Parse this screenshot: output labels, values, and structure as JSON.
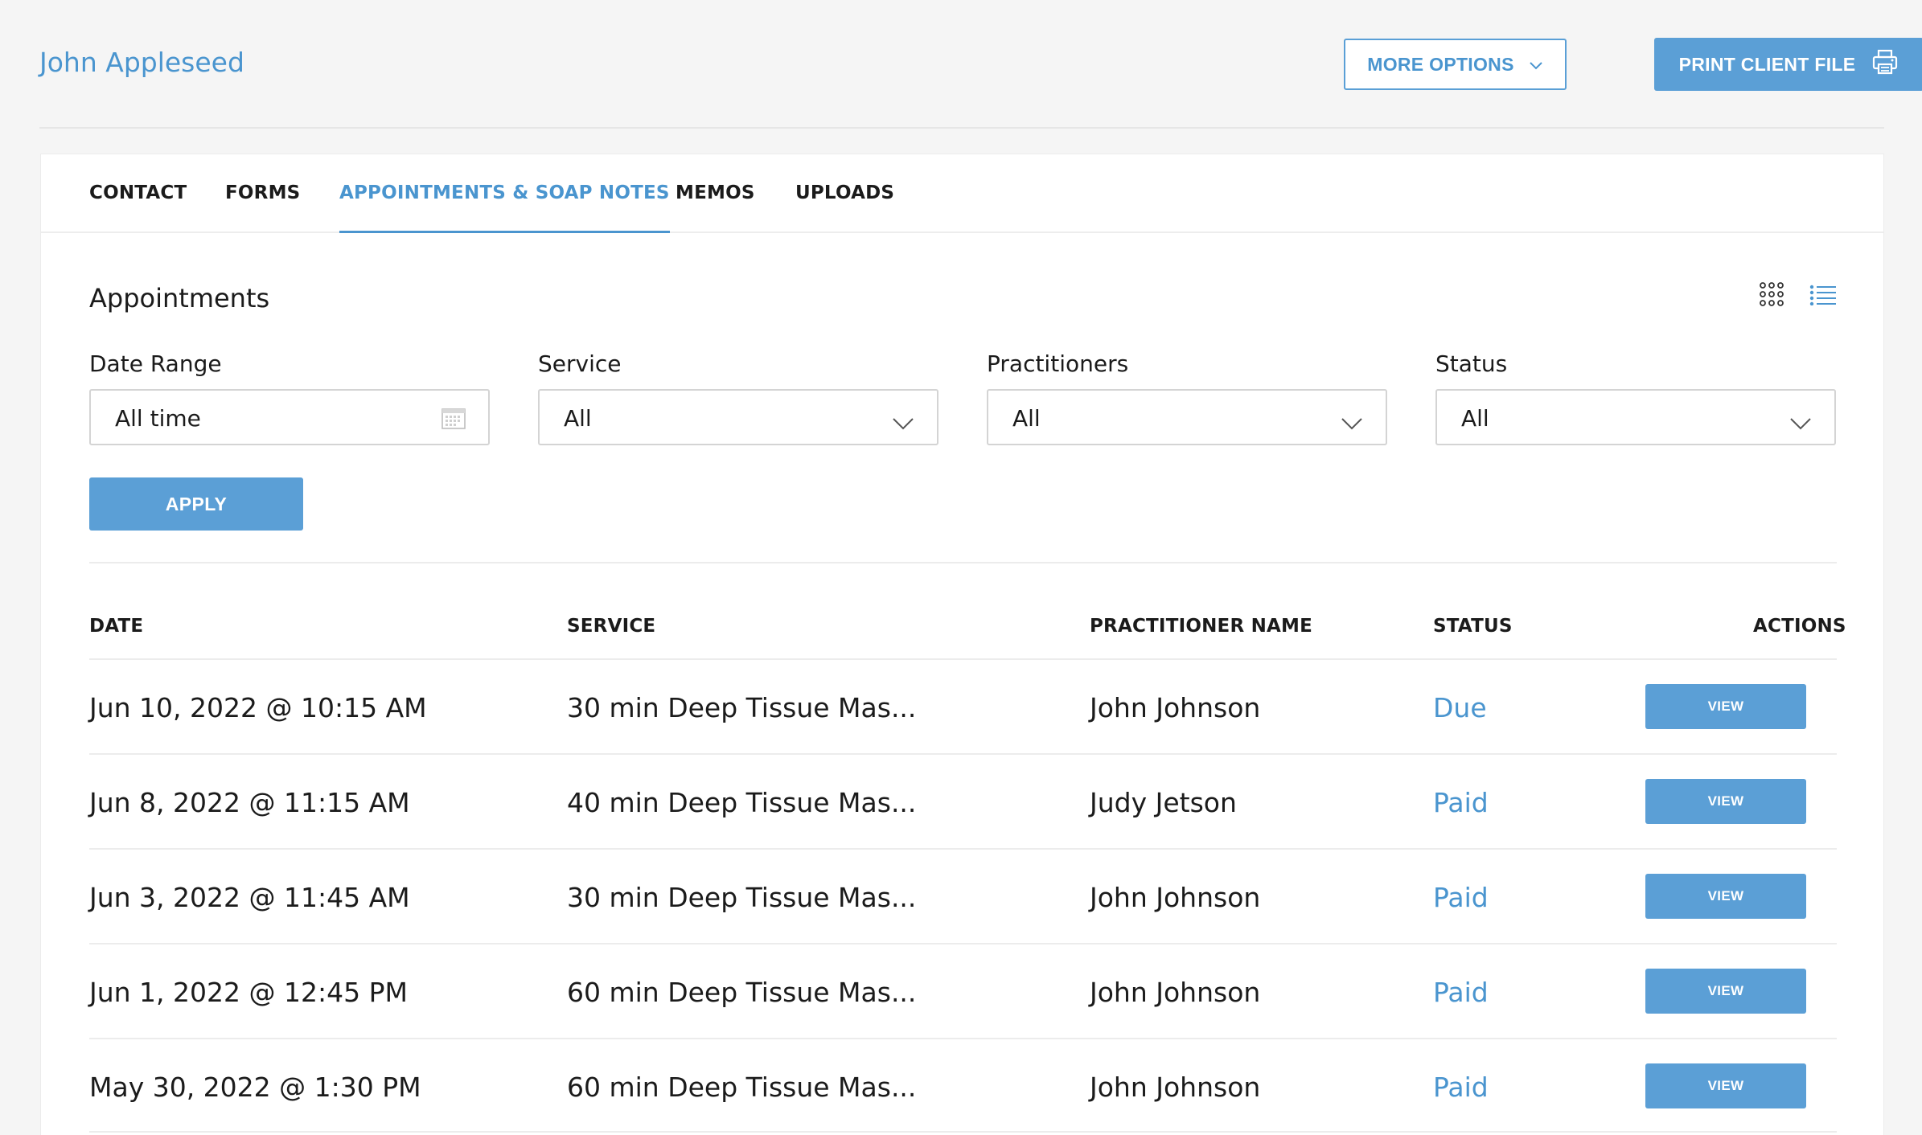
{
  "header": {
    "client_name": "John Appleseed",
    "more_options_label": "MORE OPTIONS",
    "print_label": "PRINT CLIENT FILE"
  },
  "tabs": [
    {
      "label": "CONTACT",
      "active": false
    },
    {
      "label": "FORMS",
      "active": false
    },
    {
      "label": "APPOINTMENTS & SOAP NOTES",
      "active": true
    },
    {
      "label": "MEMOS",
      "active": false
    },
    {
      "label": "UPLOADS",
      "active": false
    }
  ],
  "section": {
    "title": "Appointments",
    "view_modes": [
      "grid-icon",
      "list-icon"
    ],
    "active_view": "list"
  },
  "filters": {
    "date_range": {
      "label": "Date Range",
      "value": "All time",
      "icon": "calendar-icon"
    },
    "service": {
      "label": "Service",
      "value": "All",
      "icon": "chevron-down-icon"
    },
    "practitioners": {
      "label": "Practitioners",
      "value": "All",
      "icon": "chevron-down-icon"
    },
    "status": {
      "label": "Status",
      "value": "All",
      "icon": "chevron-down-icon"
    },
    "apply_label": "APPLY"
  },
  "table": {
    "headers": {
      "date": "DATE",
      "service": "SERVICE",
      "practitioner": "PRACTITIONER NAME",
      "status": "STATUS",
      "actions": "ACTIONS"
    },
    "rows": [
      {
        "date": "Jun 10, 2022 @ 10:15 AM",
        "service": "30 min Deep Tissue Mas...",
        "practitioner": "John Johnson",
        "status": "Due",
        "action": "VIEW"
      },
      {
        "date": "Jun 8, 2022 @ 11:15 AM",
        "service": "40 min Deep Tissue Mas...",
        "practitioner": "Judy Jetson",
        "status": "Paid",
        "action": "VIEW"
      },
      {
        "date": "Jun 3, 2022 @ 11:45 AM",
        "service": "30 min Deep Tissue Mas...",
        "practitioner": "John Johnson",
        "status": "Paid",
        "action": "VIEW"
      },
      {
        "date": "Jun 1, 2022 @ 12:45 PM",
        "service": "60 min Deep Tissue Mas...",
        "practitioner": "John Johnson",
        "status": "Paid",
        "action": "VIEW"
      },
      {
        "date": "May 30, 2022 @ 1:30 PM",
        "service": "60 min Deep Tissue Mas...",
        "practitioner": "John Johnson",
        "status": "Paid",
        "action": "VIEW"
      }
    ]
  },
  "colors": {
    "accent": "#4a95cf",
    "button": "#5b9fd6",
    "background": "#f5f5f5",
    "text": "#1b1b1b"
  }
}
